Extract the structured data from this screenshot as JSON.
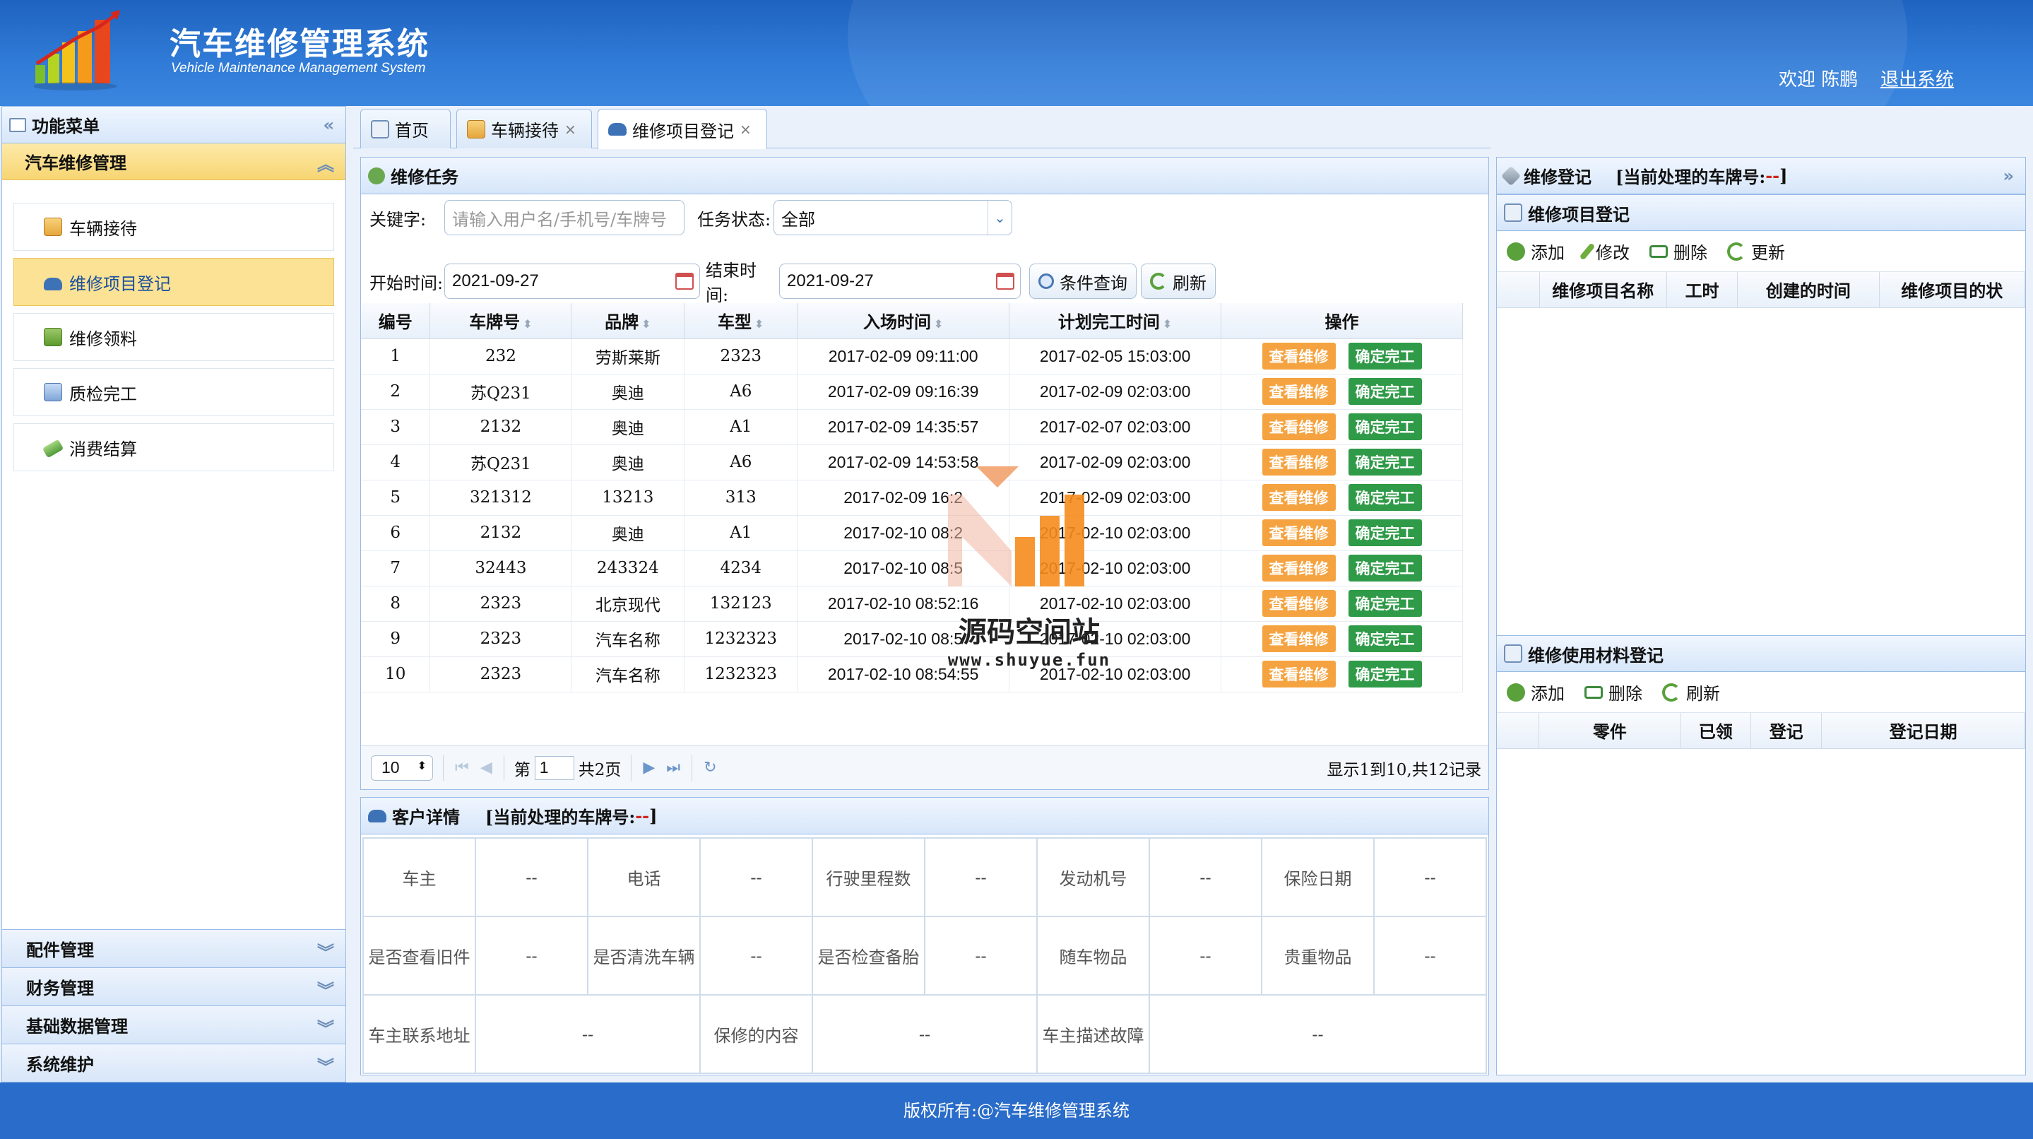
{
  "header": {
    "title": "汽车维修管理系统",
    "subtitle": "Vehicle Maintenance Management System",
    "welcome": "欢迎 陈鹏",
    "logout": "退出系统"
  },
  "sidebar": {
    "title": "功能菜单",
    "active_group": "汽车维修管理",
    "items": [
      {
        "label": "车辆接待",
        "icon": "reception-icon"
      },
      {
        "label": "维修项目登记",
        "icon": "car-icon",
        "selected": true
      },
      {
        "label": "维修领料",
        "icon": "materials-icon"
      },
      {
        "label": "质检完工",
        "icon": "inspection-icon"
      },
      {
        "label": "消费结算",
        "icon": "payment-icon"
      }
    ],
    "groups": [
      "配件管理",
      "财务管理",
      "基础数据管理",
      "系统维护"
    ]
  },
  "tabs": [
    {
      "label": "首页",
      "closable": false
    },
    {
      "label": "车辆接待",
      "closable": true
    },
    {
      "label": "维修项目登记",
      "closable": true,
      "active": true
    }
  ],
  "task_panel": {
    "title": "维修任务",
    "keyword_label": "关键字:",
    "keyword_placeholder": "请输入用户名/手机号/车牌号",
    "status_label": "任务状态:",
    "status_value": "全部",
    "start_label": "开始时间:",
    "start_value": "2021-09-27",
    "end_label": "结束时间:",
    "end_value": "2021-09-27",
    "search_button": "条件查询",
    "refresh_button": "刷新",
    "columns": [
      "编号",
      "车牌号",
      "品牌",
      "车型",
      "入场时间",
      "计划完工时间",
      "操作"
    ],
    "view_label": "查看维修",
    "complete_label": "确定完工",
    "rows": [
      [
        "1",
        "232",
        "劳斯莱斯",
        "2323",
        "2017-02-09 09:11:00",
        "2017-02-05 15:03:00"
      ],
      [
        "2",
        "苏Q231",
        "奥迪",
        "A6",
        "2017-02-09 09:16:39",
        "2017-02-09 02:03:00"
      ],
      [
        "3",
        "2132",
        "奥迪",
        "A1",
        "2017-02-09 14:35:57",
        "2017-02-07 02:03:00"
      ],
      [
        "4",
        "苏Q231",
        "奥迪",
        "A6",
        "2017-02-09 14:53:58",
        "2017-02-09 02:03:00"
      ],
      [
        "5",
        "321312",
        "13213",
        "313",
        "2017-02-09 16:2",
        "2017-02-09 02:03:00"
      ],
      [
        "6",
        "2132",
        "奥迪",
        "A1",
        "2017-02-10 08:2",
        "2017-02-10 02:03:00"
      ],
      [
        "7",
        "32443",
        "243324",
        "4234",
        "2017-02-10 08:5",
        "2017-02-10 02:03:00"
      ],
      [
        "8",
        "2323",
        "北京现代",
        "132123",
        "2017-02-10 08:52:16",
        "2017-02-10 02:03:00"
      ],
      [
        "9",
        "2323",
        "汽车名称",
        "1232323",
        "2017-02-10 08:5",
        "2017-02-10 02:03:00"
      ],
      [
        "10",
        "2323",
        "汽车名称",
        "1232323",
        "2017-02-10 08:54:55",
        "2017-02-10 02:03:00"
      ]
    ],
    "pager": {
      "page_size": "10",
      "page_prefix": "第",
      "page_value": "1",
      "page_total": "共2页",
      "summary": "显示1到10,共12记录"
    }
  },
  "customer": {
    "title": "客户详情",
    "plate_prefix": "[当前处理的车牌号: ",
    "plate_value": "--",
    "plate_suffix": "]",
    "rows": [
      [
        "车主",
        "--",
        "电话",
        "--",
        "行驶里程数",
        "--",
        "发动机号",
        "--",
        "保险日期",
        "--"
      ],
      [
        "是否查看旧件",
        "--",
        "是否清洗车辆",
        "--",
        "是否检查备胎",
        "--",
        "随车物品",
        "--",
        "贵重物品",
        "--"
      ],
      [
        "车主联系地址",
        "--",
        "保修的内容",
        "--",
        "车主描述故障",
        "--"
      ]
    ]
  },
  "right_panel": {
    "title": "维修登记",
    "plate_prefix": "[当前处理的车牌号: ",
    "plate_value": "--",
    "plate_suffix": "]",
    "items_title": "维修项目登记",
    "items_toolbar": [
      "添加",
      "修改",
      "删除",
      "更新"
    ],
    "items_columns": [
      "维修项目名称",
      "工时",
      "创建的时间",
      "维修项目的状"
    ],
    "materials_title": "维修使用材料登记",
    "materials_toolbar": [
      "添加",
      "删除",
      "刷新"
    ],
    "materials_columns": [
      "零件",
      "已领",
      "登记",
      "登记日期"
    ]
  },
  "watermark": {
    "name": "源码空间站",
    "url": "www.shuyue.fun"
  },
  "footer": "版权所有:@汽车维修管理系统",
  "colors": {
    "header_blue": "#2f7ad6",
    "selected_yellow": "#fbe294",
    "orange_button": "#f5a341",
    "green_button": "#2f9a47",
    "border_blue": "#99bbe8"
  }
}
